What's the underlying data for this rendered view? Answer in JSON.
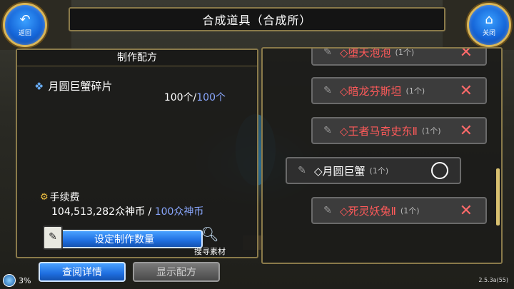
{
  "header": {
    "title": "合成道具（合成所）",
    "back_label": "返回",
    "close_label": "关闭"
  },
  "recipe": {
    "panel_title": "制作配方",
    "item_name": "月圆巨蟹碎片",
    "count_have": "100个",
    "count_sep": "/",
    "count_need": "100个",
    "fee_label": "手续费",
    "fee_have": "104,513,282众神币",
    "fee_sep": " / ",
    "fee_need": "100众神币",
    "set_quantity_label": "设定制作数量",
    "search_material_label": "搜寻素材"
  },
  "list": {
    "items": [
      {
        "name": "◇堕天泡泡",
        "count": "(1个)",
        "status": "cross"
      },
      {
        "name": "◇暗龙芬斯坦",
        "count": "(1个)",
        "status": "cross"
      },
      {
        "name": "◇王者马奇史东Ⅱ",
        "count": "(1个)",
        "status": "cross"
      },
      {
        "name": "◇月圆巨蟹",
        "count": "(1个)",
        "status": "circle",
        "selected": true
      },
      {
        "name": "◇死灵妖兔Ⅱ",
        "count": "(1个)",
        "status": "cross"
      }
    ]
  },
  "footer": {
    "detail_label": "查阅详情",
    "show_recipe_label": "显示配方",
    "progress_text": "3%",
    "version": "2.5.3a(55)"
  },
  "colors": {
    "fail_red": "#ff5a5a",
    "accent_blue": "#1e6ee0",
    "need_blue": "#8aa8ff",
    "frame_gold": "#8a7a4a"
  }
}
